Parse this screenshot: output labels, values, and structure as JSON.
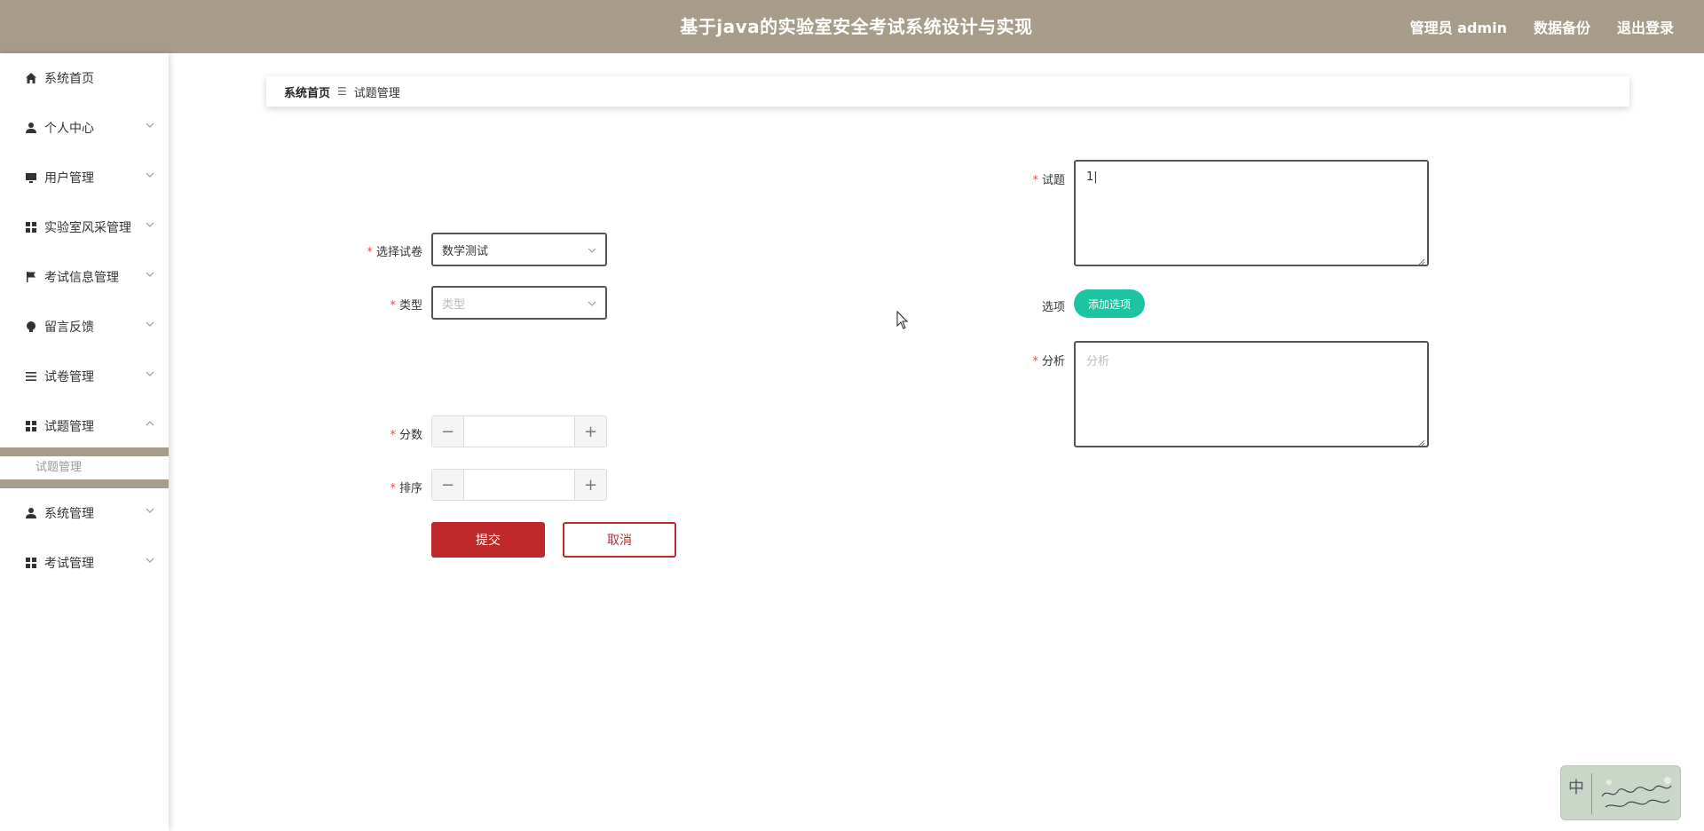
{
  "header": {
    "title": "基于java的实验室安全考试系统设计与实现",
    "admin_label": "管理员 admin",
    "backup_label": "数据备份",
    "logout_label": "退出登录"
  },
  "sidebar": {
    "items": [
      {
        "label": "系统首页",
        "icon": "home-icon",
        "has_chevron": false
      },
      {
        "label": "个人中心",
        "icon": "user-icon",
        "has_chevron": true
      },
      {
        "label": "用户管理",
        "icon": "monitor-icon",
        "has_chevron": true
      },
      {
        "label": "实验室风采管理",
        "icon": "grid-icon",
        "has_chevron": true
      },
      {
        "label": "考试信息管理",
        "icon": "flag-icon",
        "has_chevron": true
      },
      {
        "label": "留言反馈",
        "icon": "bulb-icon",
        "has_chevron": true
      },
      {
        "label": "试卷管理",
        "icon": "list-icon",
        "has_chevron": true
      },
      {
        "label": "试题管理",
        "icon": "grid-icon",
        "has_chevron": true,
        "expanded": true
      },
      {
        "label": "系统管理",
        "icon": "user-icon",
        "has_chevron": true
      },
      {
        "label": "考试管理",
        "icon": "grid-icon",
        "has_chevron": true
      }
    ],
    "submenu": {
      "label": "试题管理"
    }
  },
  "breadcrumb": {
    "home": "系统首页",
    "separator": "☰",
    "current": "试题管理"
  },
  "form": {
    "paper": {
      "label": "选择试卷",
      "value": "数学测试"
    },
    "type": {
      "label": "类型",
      "placeholder": "类型"
    },
    "score": {
      "label": "分数",
      "value": ""
    },
    "order": {
      "label": "排序",
      "value": ""
    },
    "question": {
      "label": "试题",
      "value": "1|"
    },
    "options": {
      "label": "选项",
      "add_label": "添加选项"
    },
    "analysis": {
      "label": "分析",
      "placeholder": "分析"
    },
    "required_mark": "*",
    "submit_label": "提交",
    "cancel_label": "取消"
  },
  "widget": {
    "lang_label": "中"
  },
  "colors": {
    "header_bg": "#a69c89",
    "primary_red": "#c0292b",
    "teal": "#1cc5a2",
    "required": "#e34d4d"
  }
}
